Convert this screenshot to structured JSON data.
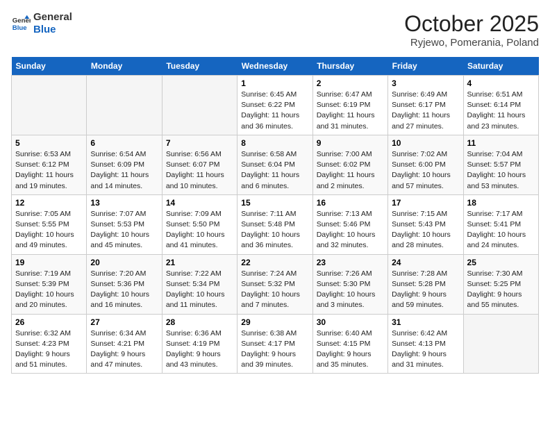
{
  "logo": {
    "line1": "General",
    "line2": "Blue"
  },
  "title": "October 2025",
  "location": "Ryjewo, Pomerania, Poland",
  "days_of_week": [
    "Sunday",
    "Monday",
    "Tuesday",
    "Wednesday",
    "Thursday",
    "Friday",
    "Saturday"
  ],
  "weeks": [
    [
      {
        "day": "",
        "info": ""
      },
      {
        "day": "",
        "info": ""
      },
      {
        "day": "",
        "info": ""
      },
      {
        "day": "1",
        "info": "Sunrise: 6:45 AM\nSunset: 6:22 PM\nDaylight: 11 hours and 36 minutes."
      },
      {
        "day": "2",
        "info": "Sunrise: 6:47 AM\nSunset: 6:19 PM\nDaylight: 11 hours and 31 minutes."
      },
      {
        "day": "3",
        "info": "Sunrise: 6:49 AM\nSunset: 6:17 PM\nDaylight: 11 hours and 27 minutes."
      },
      {
        "day": "4",
        "info": "Sunrise: 6:51 AM\nSunset: 6:14 PM\nDaylight: 11 hours and 23 minutes."
      }
    ],
    [
      {
        "day": "5",
        "info": "Sunrise: 6:53 AM\nSunset: 6:12 PM\nDaylight: 11 hours and 19 minutes."
      },
      {
        "day": "6",
        "info": "Sunrise: 6:54 AM\nSunset: 6:09 PM\nDaylight: 11 hours and 14 minutes."
      },
      {
        "day": "7",
        "info": "Sunrise: 6:56 AM\nSunset: 6:07 PM\nDaylight: 11 hours and 10 minutes."
      },
      {
        "day": "8",
        "info": "Sunrise: 6:58 AM\nSunset: 6:04 PM\nDaylight: 11 hours and 6 minutes."
      },
      {
        "day": "9",
        "info": "Sunrise: 7:00 AM\nSunset: 6:02 PM\nDaylight: 11 hours and 2 minutes."
      },
      {
        "day": "10",
        "info": "Sunrise: 7:02 AM\nSunset: 6:00 PM\nDaylight: 10 hours and 57 minutes."
      },
      {
        "day": "11",
        "info": "Sunrise: 7:04 AM\nSunset: 5:57 PM\nDaylight: 10 hours and 53 minutes."
      }
    ],
    [
      {
        "day": "12",
        "info": "Sunrise: 7:05 AM\nSunset: 5:55 PM\nDaylight: 10 hours and 49 minutes."
      },
      {
        "day": "13",
        "info": "Sunrise: 7:07 AM\nSunset: 5:53 PM\nDaylight: 10 hours and 45 minutes."
      },
      {
        "day": "14",
        "info": "Sunrise: 7:09 AM\nSunset: 5:50 PM\nDaylight: 10 hours and 41 minutes."
      },
      {
        "day": "15",
        "info": "Sunrise: 7:11 AM\nSunset: 5:48 PM\nDaylight: 10 hours and 36 minutes."
      },
      {
        "day": "16",
        "info": "Sunrise: 7:13 AM\nSunset: 5:46 PM\nDaylight: 10 hours and 32 minutes."
      },
      {
        "day": "17",
        "info": "Sunrise: 7:15 AM\nSunset: 5:43 PM\nDaylight: 10 hours and 28 minutes."
      },
      {
        "day": "18",
        "info": "Sunrise: 7:17 AM\nSunset: 5:41 PM\nDaylight: 10 hours and 24 minutes."
      }
    ],
    [
      {
        "day": "19",
        "info": "Sunrise: 7:19 AM\nSunset: 5:39 PM\nDaylight: 10 hours and 20 minutes."
      },
      {
        "day": "20",
        "info": "Sunrise: 7:20 AM\nSunset: 5:36 PM\nDaylight: 10 hours and 16 minutes."
      },
      {
        "day": "21",
        "info": "Sunrise: 7:22 AM\nSunset: 5:34 PM\nDaylight: 10 hours and 11 minutes."
      },
      {
        "day": "22",
        "info": "Sunrise: 7:24 AM\nSunset: 5:32 PM\nDaylight: 10 hours and 7 minutes."
      },
      {
        "day": "23",
        "info": "Sunrise: 7:26 AM\nSunset: 5:30 PM\nDaylight: 10 hours and 3 minutes."
      },
      {
        "day": "24",
        "info": "Sunrise: 7:28 AM\nSunset: 5:28 PM\nDaylight: 9 hours and 59 minutes."
      },
      {
        "day": "25",
        "info": "Sunrise: 7:30 AM\nSunset: 5:25 PM\nDaylight: 9 hours and 55 minutes."
      }
    ],
    [
      {
        "day": "26",
        "info": "Sunrise: 6:32 AM\nSunset: 4:23 PM\nDaylight: 9 hours and 51 minutes."
      },
      {
        "day": "27",
        "info": "Sunrise: 6:34 AM\nSunset: 4:21 PM\nDaylight: 9 hours and 47 minutes."
      },
      {
        "day": "28",
        "info": "Sunrise: 6:36 AM\nSunset: 4:19 PM\nDaylight: 9 hours and 43 minutes."
      },
      {
        "day": "29",
        "info": "Sunrise: 6:38 AM\nSunset: 4:17 PM\nDaylight: 9 hours and 39 minutes."
      },
      {
        "day": "30",
        "info": "Sunrise: 6:40 AM\nSunset: 4:15 PM\nDaylight: 9 hours and 35 minutes."
      },
      {
        "day": "31",
        "info": "Sunrise: 6:42 AM\nSunset: 4:13 PM\nDaylight: 9 hours and 31 minutes."
      },
      {
        "day": "",
        "info": ""
      }
    ]
  ]
}
